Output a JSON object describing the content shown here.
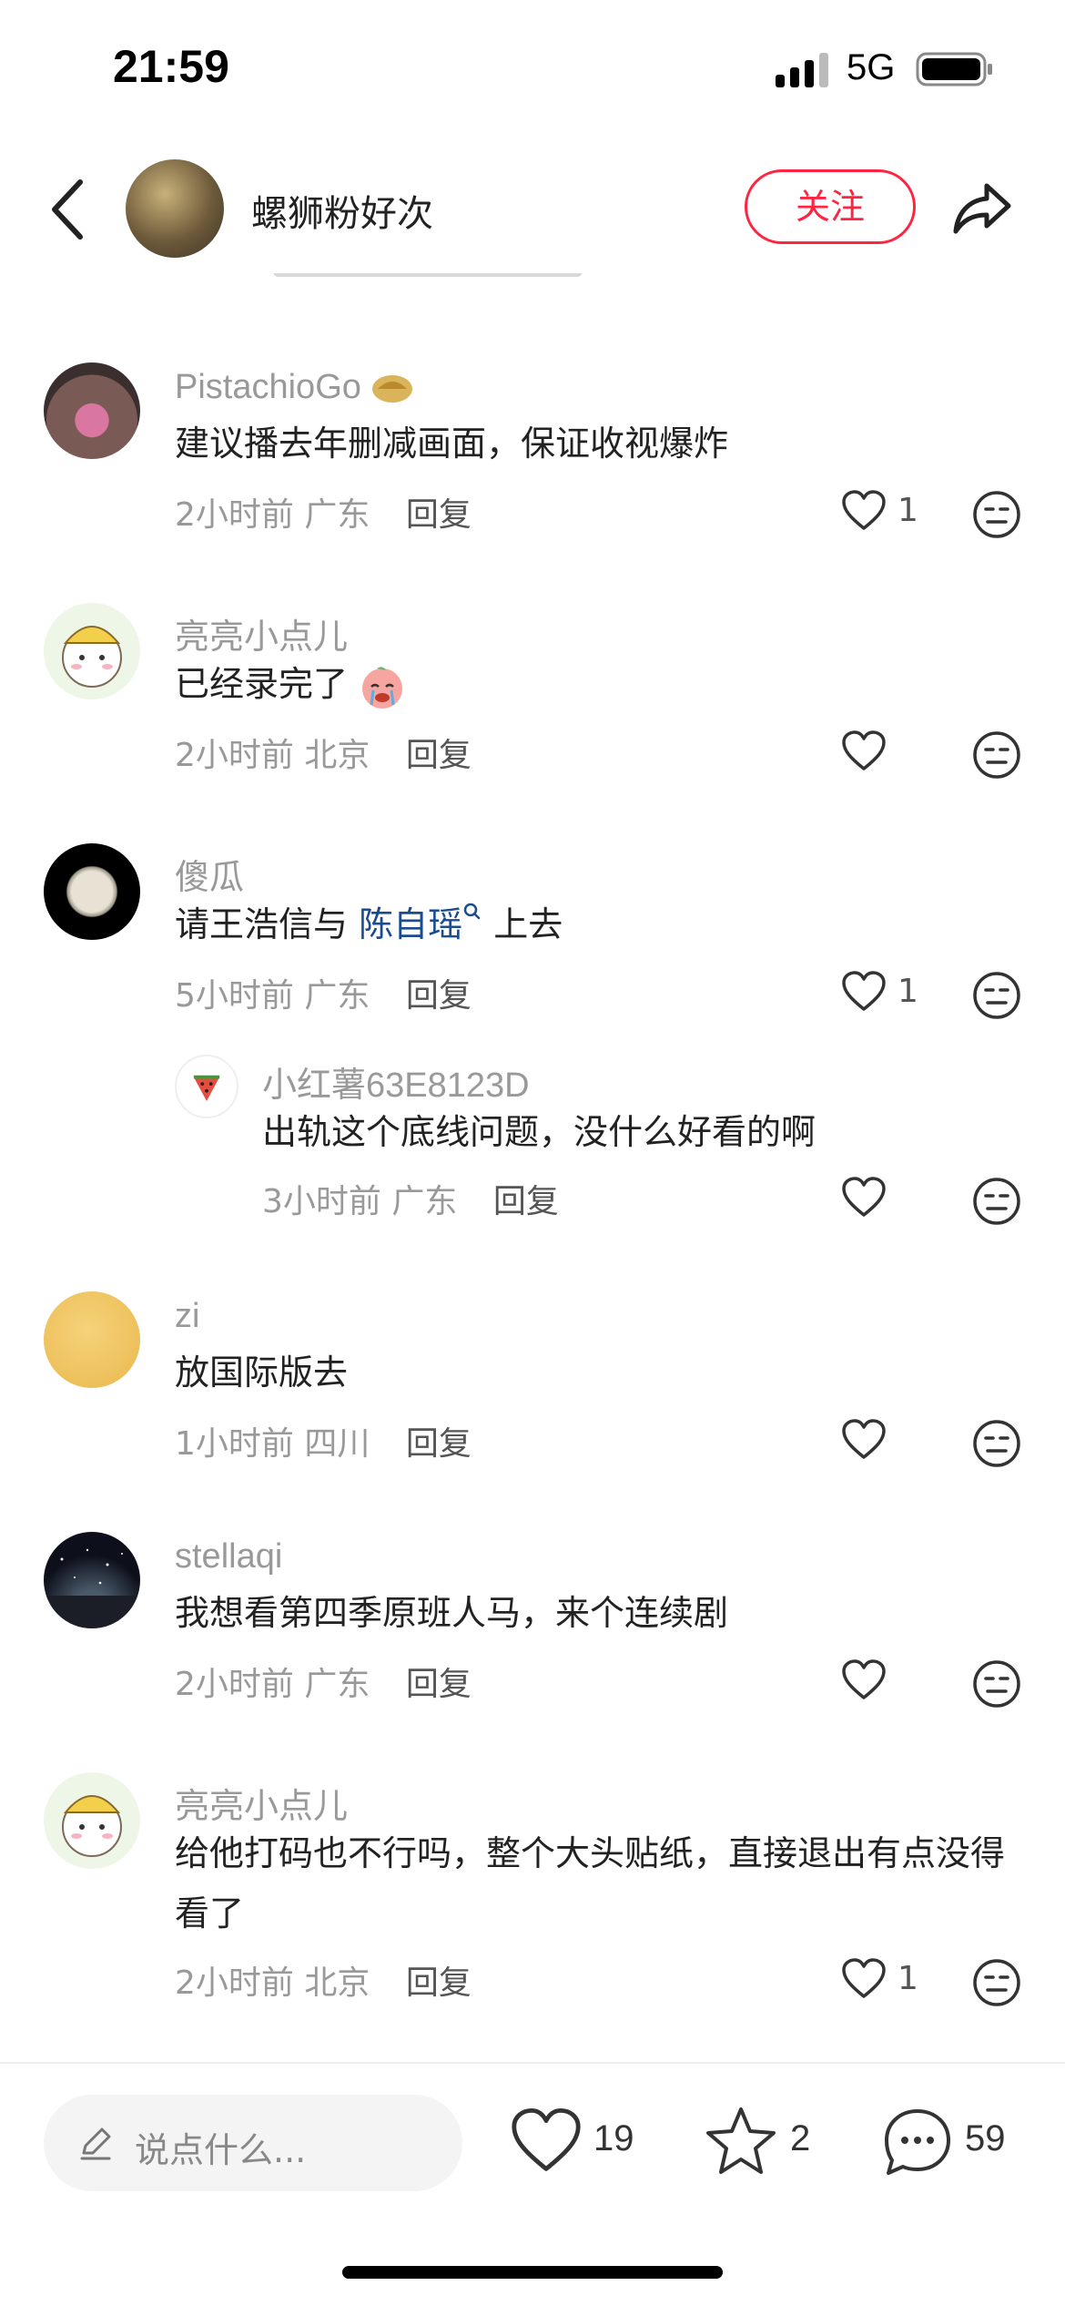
{
  "status_bar": {
    "time": "21:59",
    "network": "5G"
  },
  "header": {
    "author_name": "螺狮粉好次",
    "follow_label": "关注"
  },
  "comments": [
    {
      "username": "PistachioGo",
      "badge": "pistachio-emoji",
      "text": "建议播去年删减画面，保证收视爆炸",
      "time": "2小时前",
      "location": "广东",
      "reply_label": "回复",
      "likes": "1"
    },
    {
      "username": "亮亮小点儿",
      "text_before": "已经录完了",
      "emoji": "crying-peach-emoji",
      "time": "2小时前",
      "location": "北京",
      "reply_label": "回复",
      "likes": ""
    },
    {
      "username": "傻瓜",
      "text_before": "请王浩信与 ",
      "mention": "陈自瑶",
      "text_after": " 上去",
      "time": "5小时前",
      "location": "广东",
      "reply_label": "回复",
      "likes": "1",
      "reply": {
        "username": "小红薯63E8123D",
        "text": "出轨这个底线问题，没什么好看的啊",
        "time": "3小时前",
        "location": "广东",
        "reply_label": "回复",
        "likes": ""
      }
    },
    {
      "username": "zi",
      "text": "放国际版去",
      "time": "1小时前",
      "location": "四川",
      "reply_label": "回复",
      "likes": ""
    },
    {
      "username": "stellaqi",
      "text": "我想看第四季原班人马，来个连续剧",
      "time": "2小时前",
      "location": "广东",
      "reply_label": "回复",
      "likes": ""
    },
    {
      "username": "亮亮小点儿",
      "text": "给他打码也不行吗，整个大头贴纸，直接退出有点没得看了",
      "time": "2小时前",
      "location": "北京",
      "reply_label": "回复",
      "likes": "1"
    }
  ],
  "bottom_bar": {
    "input_placeholder": "说点什么...",
    "like_count": "19",
    "collect_count": "2",
    "comment_count": "59"
  },
  "colors": {
    "accent": "#ff2442",
    "mention": "#1a4c8e",
    "muted": "#999999"
  }
}
